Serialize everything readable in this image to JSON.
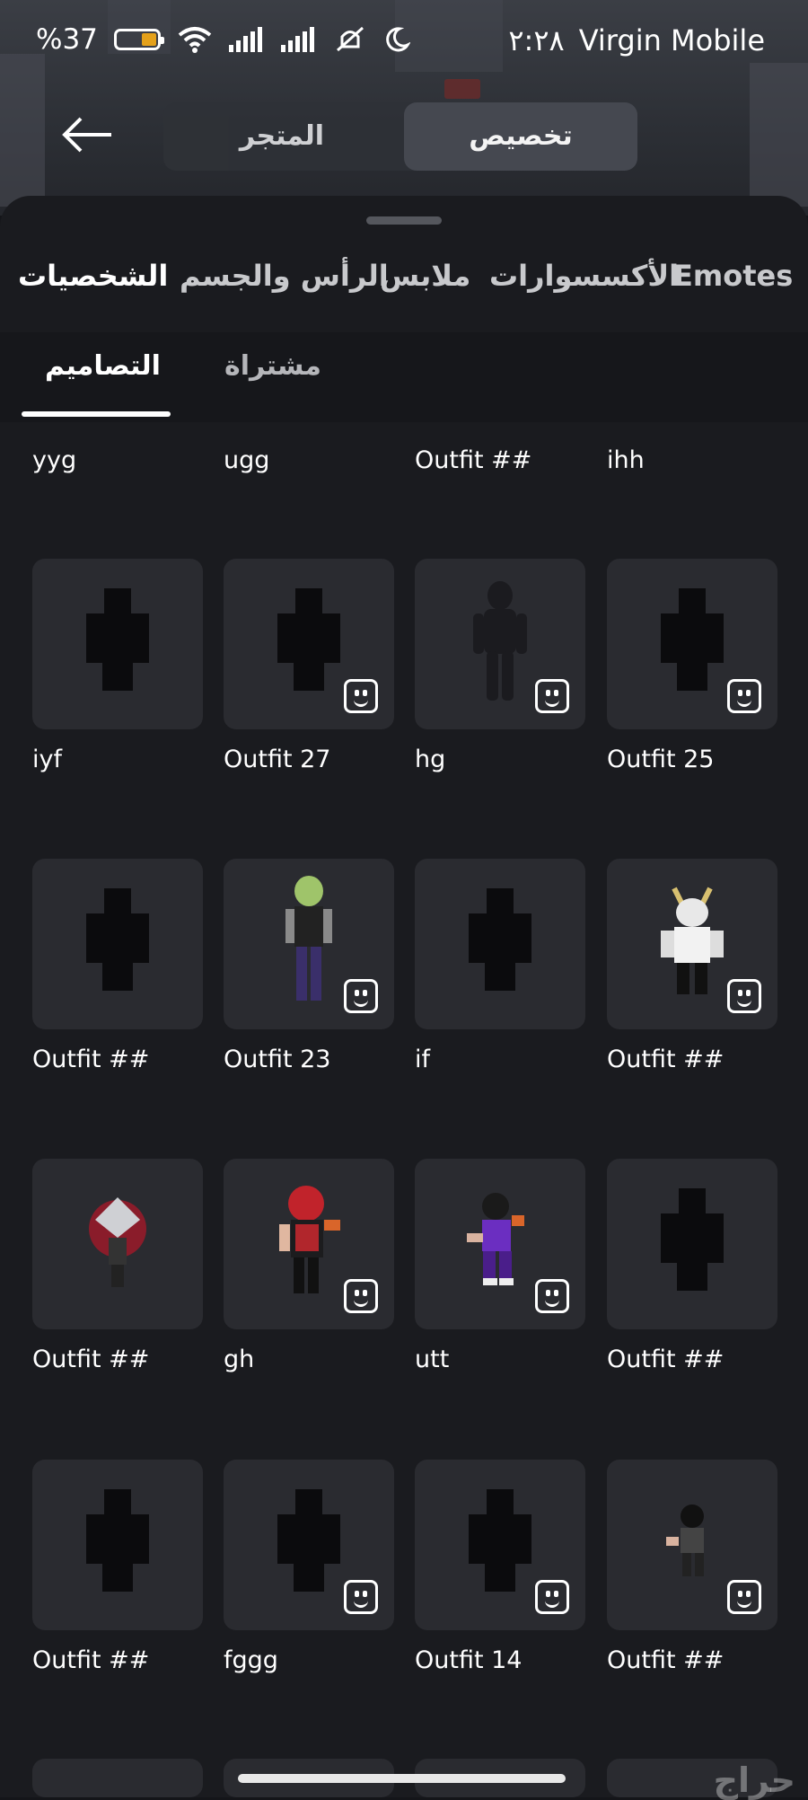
{
  "status": {
    "battery": "%37",
    "time": "٢:٢٨",
    "carrier": "Virgin Mobile"
  },
  "header": {
    "tabs": {
      "store": "المتجر",
      "customize": "تخصيص"
    }
  },
  "categories": [
    "Emotes",
    "الأكسسوارات",
    "ملابس",
    "الرأس والجسم",
    "الشخصيات"
  ],
  "subtabs": {
    "purchased": "مشتراة",
    "creations": "التصاميم"
  },
  "top_names": [
    "yyg",
    "ugg",
    "Outfit ##",
    "ihh"
  ],
  "rows": [
    [
      {
        "name": "iyf",
        "emote": false,
        "avatar": "blank"
      },
      {
        "name": "Outfit 27",
        "emote": true,
        "avatar": "blank"
      },
      {
        "name": "hg",
        "emote": true,
        "avatar": "black"
      },
      {
        "name": "Outfit 25",
        "emote": true,
        "avatar": "blank"
      }
    ],
    [
      {
        "name": "Outfit ##",
        "emote": false,
        "avatar": "blank"
      },
      {
        "name": "Outfit 23",
        "emote": true,
        "avatar": "alien"
      },
      {
        "name": "if",
        "emote": false,
        "avatar": "blank"
      },
      {
        "name": "Outfit ##",
        "emote": true,
        "avatar": "white"
      }
    ],
    [
      {
        "name": "Outfit ##",
        "emote": false,
        "avatar": "silver"
      },
      {
        "name": "gh",
        "emote": true,
        "avatar": "redhair"
      },
      {
        "name": "utt",
        "emote": true,
        "avatar": "purple"
      },
      {
        "name": "Outfit ##",
        "emote": false,
        "avatar": "blank"
      }
    ],
    [
      {
        "name": "Outfit ##",
        "emote": false,
        "avatar": "blank"
      },
      {
        "name": "fggg",
        "emote": true,
        "avatar": "blank"
      },
      {
        "name": "Outfit 14",
        "emote": true,
        "avatar": "blank"
      },
      {
        "name": "Outfit ##",
        "emote": true,
        "avatar": "small"
      }
    ]
  ],
  "watermark": "حراج",
  "colors": {
    "accent": "#e4a11b",
    "card": "#2a2b30",
    "sheet": "#1a1b1f"
  }
}
